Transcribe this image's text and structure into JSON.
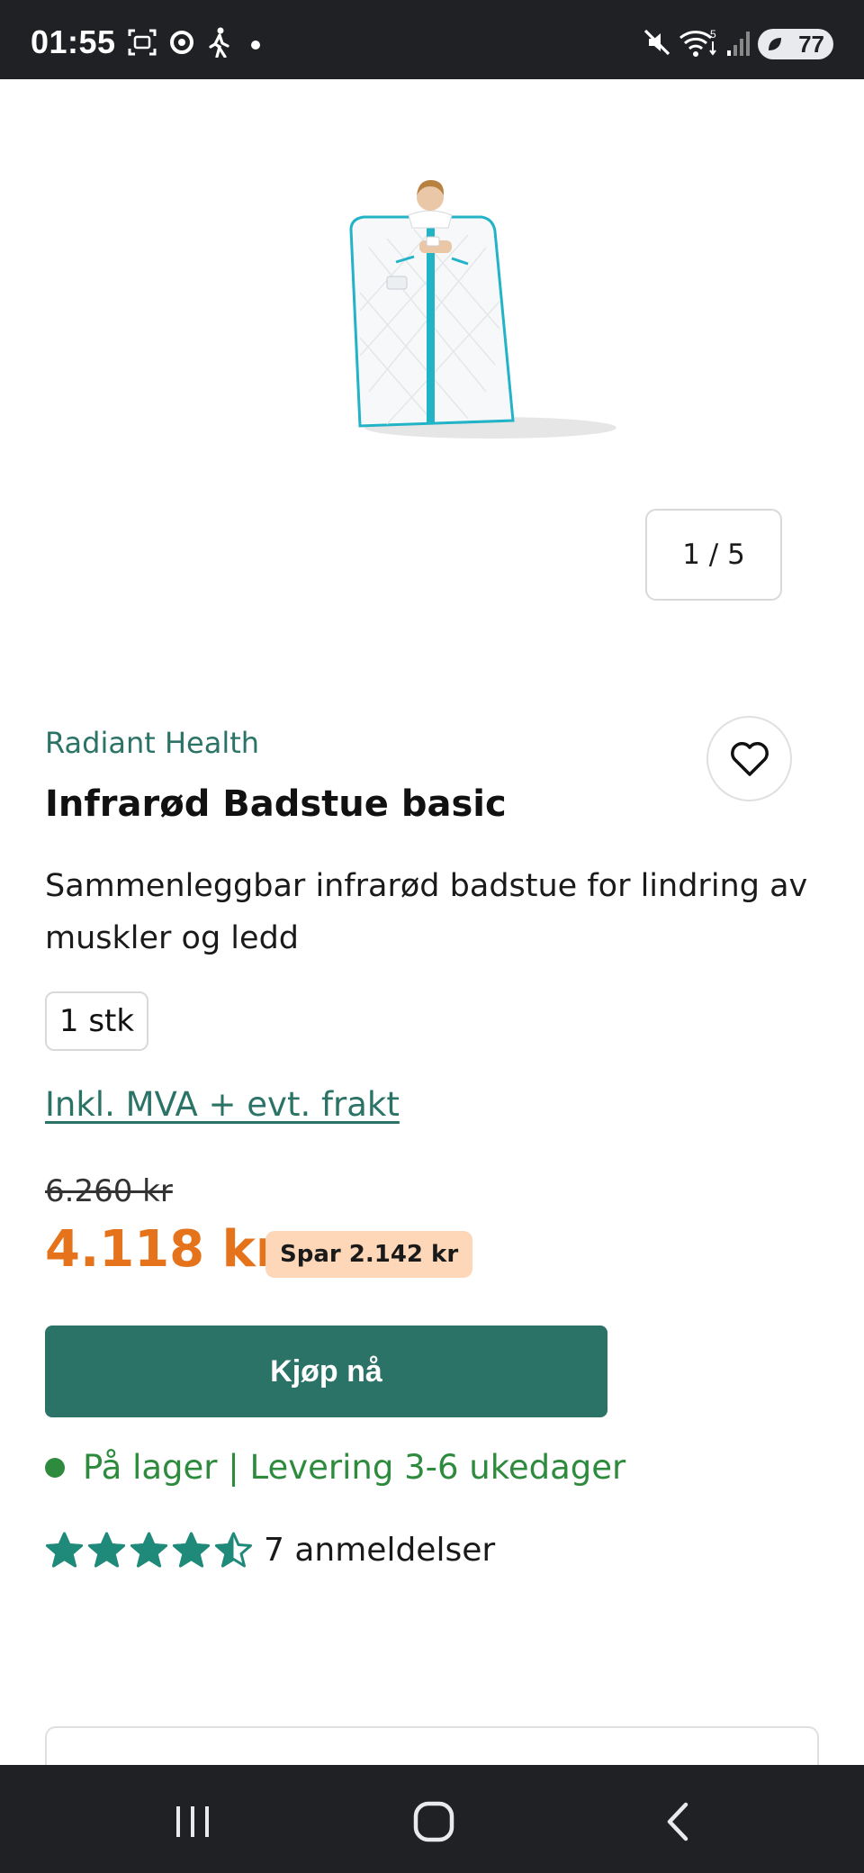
{
  "status_bar": {
    "time": "01:55",
    "battery_level": "77",
    "icons": [
      "screenshot-icon",
      "sync-icon",
      "walking-icon",
      "dot-icon",
      "mute-icon",
      "wifi-icon",
      "signal-icon",
      "battery-icon"
    ]
  },
  "gallery": {
    "pager": "1 / 5",
    "current": 1,
    "total": 5
  },
  "product": {
    "brand": "Radiant Health",
    "title": "Infrarød Badstue basic",
    "description": "Sammenleggbar infrarød badstue for lindring av muskler og ledd",
    "variant": "1 stk",
    "vat_note": "Inkl. MVA + evt. frakt",
    "old_price": "6.260 kr",
    "price": "4.118 kr",
    "save_badge": "Spar 2.142 kr",
    "buy_label": "Kjøp nå",
    "stock_text": "På lager | Levering 3-6 ukedager",
    "rating": 4.5,
    "rating_max": 5,
    "review_text": "7 anmeldelser"
  },
  "colors": {
    "brand_green": "#2a7366",
    "price_orange": "#e5731b",
    "badge_bg": "#fdd7b8",
    "stock_green": "#2e8b3e",
    "star_teal": "#1f8a7a"
  }
}
